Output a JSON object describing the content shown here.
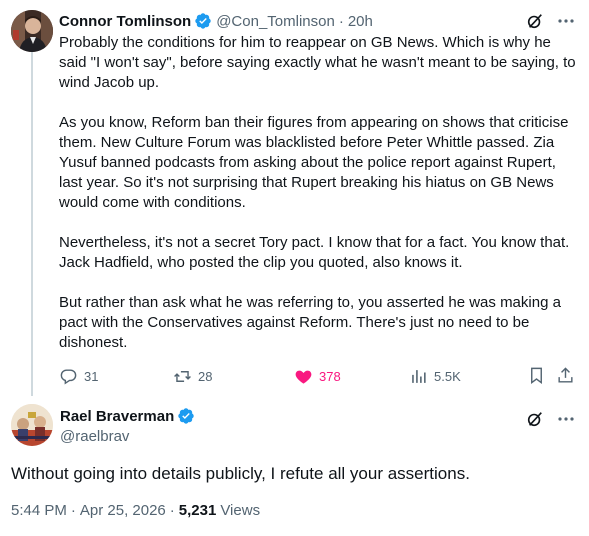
{
  "colors": {
    "text_primary": "#0f1419",
    "text_secondary": "#536471",
    "verified_blue": "#1d9bf0",
    "like_pink": "#f91880",
    "thread_line": "#cfd9de"
  },
  "reply": {
    "author_name": "Connor Tomlinson",
    "author_handle": "@Con_Tomlinson",
    "separator": "·",
    "time_ago": "20h",
    "paragraphs": [
      "Probably the conditions for him to reappear on GB News. Which is why he said \"I won't say\", before saying exactly what he wasn't meant to be saying, to wind Jacob up.",
      "As you know, Reform ban their figures from appearing on shows that criticise them. New Culture Forum was blacklisted before Peter Whittle passed. Zia Yusuf banned podcasts from asking about the police report against Rupert, last year. So it's not surprising that Rupert breaking his hiatus on GB News would come with conditions.",
      "Nevertheless, it's not a secret Tory pact. I know that for a fact. You know that. Jack Hadfield, who posted the clip you quoted, also knows it.",
      "But rather than ask what he was referring to, you asserted he was making a pact with the Conservatives against Reform. There's just no need to be dishonest."
    ],
    "actions": {
      "replies": "31",
      "reposts": "28",
      "likes": "378",
      "views": "5.5K"
    },
    "icons": [
      "verified-badge-icon",
      "grok-icon",
      "more-icon",
      "reply-icon",
      "repost-icon",
      "like-filled-icon",
      "views-icon",
      "bookmark-icon",
      "share-icon"
    ]
  },
  "main_post": {
    "author_name": "Rael Braverman",
    "author_handle": "@raelbrav",
    "text": "Without going into details publicly, I refute all your assertions.",
    "time": "5:44 PM",
    "separator": "·",
    "date": "Apr 25, 2026",
    "views_count": "5,231",
    "views_label": "Views"
  }
}
